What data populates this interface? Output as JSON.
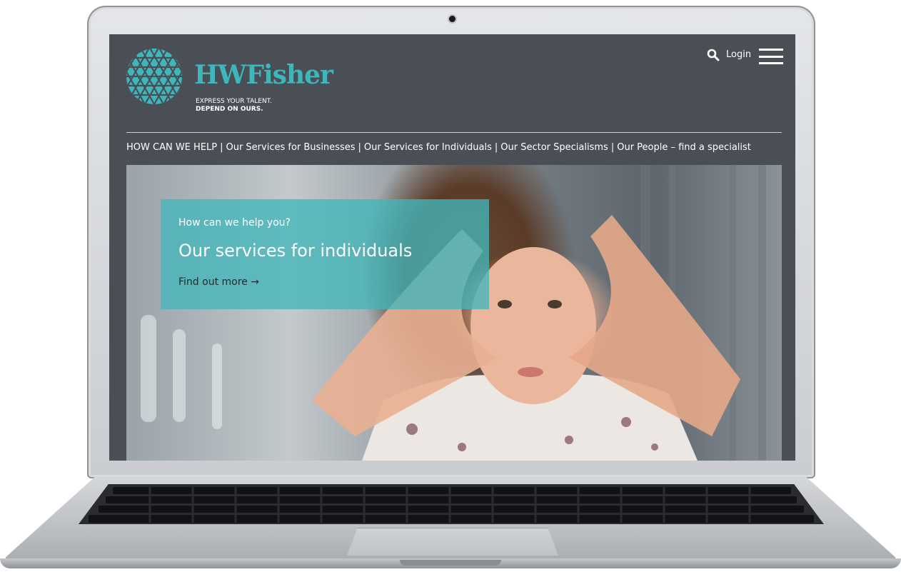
{
  "site": {
    "brand": "HWFisher",
    "tagline_line1": "EXPRESS YOUR TALENT.",
    "tagline_line2": "DEPEND ON OURS.",
    "login_label": "Login"
  },
  "nav": {
    "items": [
      "HOW CAN WE HELP",
      "Our Services for Businesses",
      "Our Services for Individuals",
      "Our Sector Specialisms",
      "Our People – find a specialist"
    ],
    "separator": "|"
  },
  "hero": {
    "kicker": "How can we help you?",
    "headline": "Our services for individuals",
    "cta": "Find out more →"
  },
  "colors": {
    "header_bg": "#4a4f56",
    "brand_teal": "#3fb6ba",
    "promo_bg": "#42b6ba"
  },
  "icons": {
    "search": "search-icon",
    "menu": "hamburger-menu-icon",
    "logo": "logo-triangle-grid-icon"
  }
}
